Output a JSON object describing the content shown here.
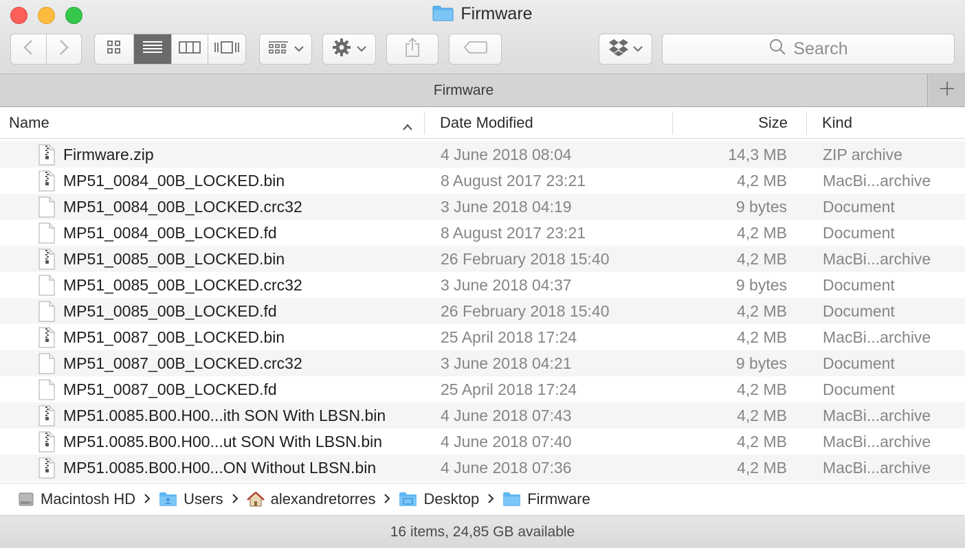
{
  "window": {
    "title": "Firmware"
  },
  "toolbar": {
    "search_placeholder": "Search",
    "icons": [
      "back-icon",
      "forward-icon",
      "icon-view-icon",
      "list-view-icon",
      "column-view-icon",
      "cover-flow-icon",
      "group-icon",
      "gear-icon",
      "share-icon",
      "tag-icon",
      "dropbox-icon",
      "search-icon"
    ]
  },
  "tab": {
    "label": "Firmware"
  },
  "columns": {
    "name": "Name",
    "date": "Date Modified",
    "size": "Size",
    "kind": "Kind"
  },
  "files": [
    {
      "name": "Firmware.zip",
      "date": "4 June 2018 08:04",
      "size": "14,3 MB",
      "kind": "ZIP archive",
      "icon": "zip"
    },
    {
      "name": "MP51_0084_00B_LOCKED.bin",
      "date": "8 August 2017 23:21",
      "size": "4,2 MB",
      "kind": "MacBi...archive",
      "icon": "zip"
    },
    {
      "name": "MP51_0084_00B_LOCKED.crc32",
      "date": "3 June 2018 04:19",
      "size": "9 bytes",
      "kind": "Document",
      "icon": "doc"
    },
    {
      "name": "MP51_0084_00B_LOCKED.fd",
      "date": "8 August 2017 23:21",
      "size": "4,2 MB",
      "kind": "Document",
      "icon": "doc"
    },
    {
      "name": "MP51_0085_00B_LOCKED.bin",
      "date": "26 February 2018 15:40",
      "size": "4,2 MB",
      "kind": "MacBi...archive",
      "icon": "zip"
    },
    {
      "name": "MP51_0085_00B_LOCKED.crc32",
      "date": "3 June 2018 04:37",
      "size": "9 bytes",
      "kind": "Document",
      "icon": "doc"
    },
    {
      "name": "MP51_0085_00B_LOCKED.fd",
      "date": "26 February 2018 15:40",
      "size": "4,2 MB",
      "kind": "Document",
      "icon": "doc"
    },
    {
      "name": "MP51_0087_00B_LOCKED.bin",
      "date": "25 April 2018 17:24",
      "size": "4,2 MB",
      "kind": "MacBi...archive",
      "icon": "zip"
    },
    {
      "name": "MP51_0087_00B_LOCKED.crc32",
      "date": "3 June 2018 04:21",
      "size": "9 bytes",
      "kind": "Document",
      "icon": "doc"
    },
    {
      "name": "MP51_0087_00B_LOCKED.fd",
      "date": "25 April 2018 17:24",
      "size": "4,2 MB",
      "kind": "Document",
      "icon": "doc"
    },
    {
      "name": "MP51.0085.B00.H00...ith SON With LBSN.bin",
      "date": "4 June 2018 07:43",
      "size": "4,2 MB",
      "kind": "MacBi...archive",
      "icon": "zip"
    },
    {
      "name": "MP51.0085.B00.H00...ut SON With LBSN.bin",
      "date": "4 June 2018 07:40",
      "size": "4,2 MB",
      "kind": "MacBi...archive",
      "icon": "zip"
    },
    {
      "name": "MP51.0085.B00.H00...ON Without LBSN.bin",
      "date": "4 June 2018 07:36",
      "size": "4,2 MB",
      "kind": "MacBi...archive",
      "icon": "zip"
    }
  ],
  "path": [
    {
      "label": "Macintosh HD",
      "icon": "hard-drive-icon"
    },
    {
      "label": "Users",
      "icon": "folder-users-icon"
    },
    {
      "label": "alexandretorres",
      "icon": "home-icon"
    },
    {
      "label": "Desktop",
      "icon": "folder-desktop-icon"
    },
    {
      "label": "Firmware",
      "icon": "folder-icon"
    }
  ],
  "status": {
    "text": "16 items, 24,85 GB available"
  },
  "colors": {
    "folder_blue": "#5fb6f3",
    "close": "#fc605b",
    "minimize": "#fdbc40",
    "maximize": "#34c84a",
    "active_segment": "#6a6a6a"
  }
}
